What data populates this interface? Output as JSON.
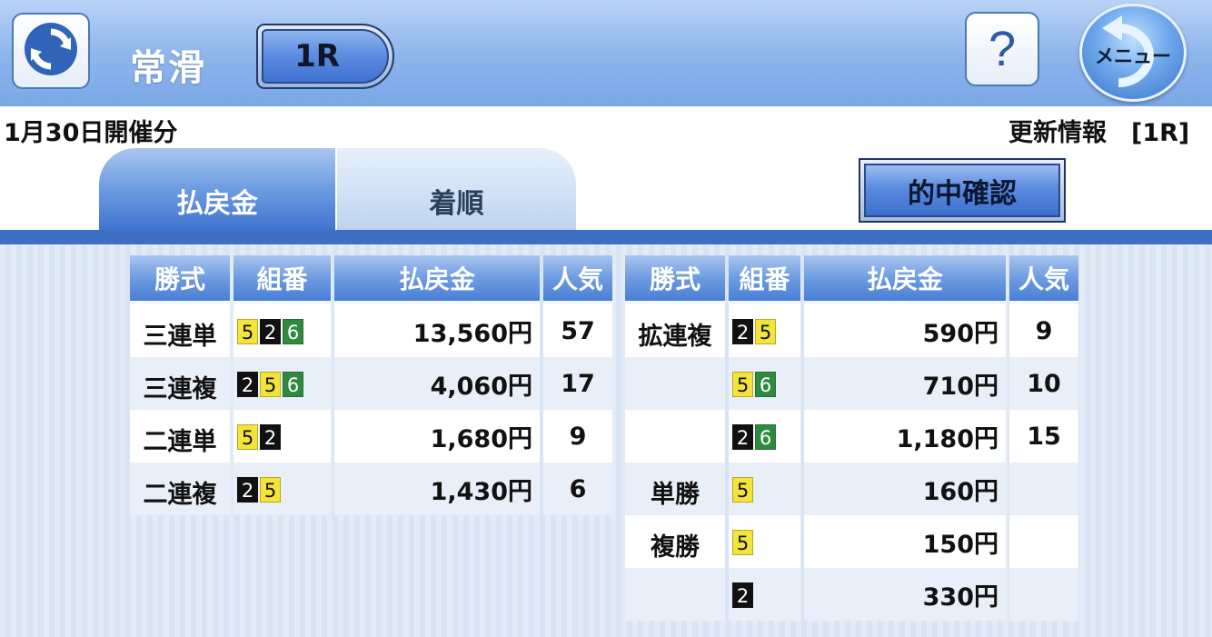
{
  "header": {
    "venue": "常滑",
    "race": "1R",
    "help_label": "?",
    "menu_label": "メニュー"
  },
  "info": {
    "date": "1月30日開催分",
    "update": "更新情報　[1R]"
  },
  "tabs": [
    {
      "label": "払戻金",
      "active": true
    },
    {
      "label": "着順",
      "active": false
    }
  ],
  "confirm_label": "的中確認",
  "table_headers": {
    "type": "勝式",
    "combo": "組番",
    "amount": "払戻金",
    "popularity": "人気"
  },
  "left_rows": [
    {
      "type": "三連単",
      "combo": [
        "5",
        "2",
        "6"
      ],
      "amount": "13,560円",
      "popularity": "57"
    },
    {
      "type": "三連複",
      "combo": [
        "2",
        "5",
        "6"
      ],
      "amount": "4,060円",
      "popularity": "17"
    },
    {
      "type": "二連単",
      "combo": [
        "5",
        "2"
      ],
      "amount": "1,680円",
      "popularity": "9"
    },
    {
      "type": "二連複",
      "combo": [
        "2",
        "5"
      ],
      "amount": "1,430円",
      "popularity": "6"
    }
  ],
  "right_rows": [
    {
      "type": "拡連複",
      "combo": [
        "2",
        "5"
      ],
      "amount": "590円",
      "popularity": "9"
    },
    {
      "type": "",
      "combo": [
        "5",
        "6"
      ],
      "amount": "710円",
      "popularity": "10"
    },
    {
      "type": "",
      "combo": [
        "2",
        "6"
      ],
      "amount": "1,180円",
      "popularity": "15"
    },
    {
      "type": "単勝",
      "combo": [
        "5"
      ],
      "amount": "160円",
      "popularity": ""
    },
    {
      "type": "複勝",
      "combo": [
        "5"
      ],
      "amount": "150円",
      "popularity": ""
    },
    {
      "type": "",
      "combo": [
        "2"
      ],
      "amount": "330円",
      "popularity": ""
    }
  ],
  "colors": {
    "header_blue": "#7aa7e6",
    "divider_blue": "#3e6fc2",
    "boat_2": "#111111",
    "boat_5": "#f2e43a",
    "boat_6": "#2f8a3f"
  }
}
